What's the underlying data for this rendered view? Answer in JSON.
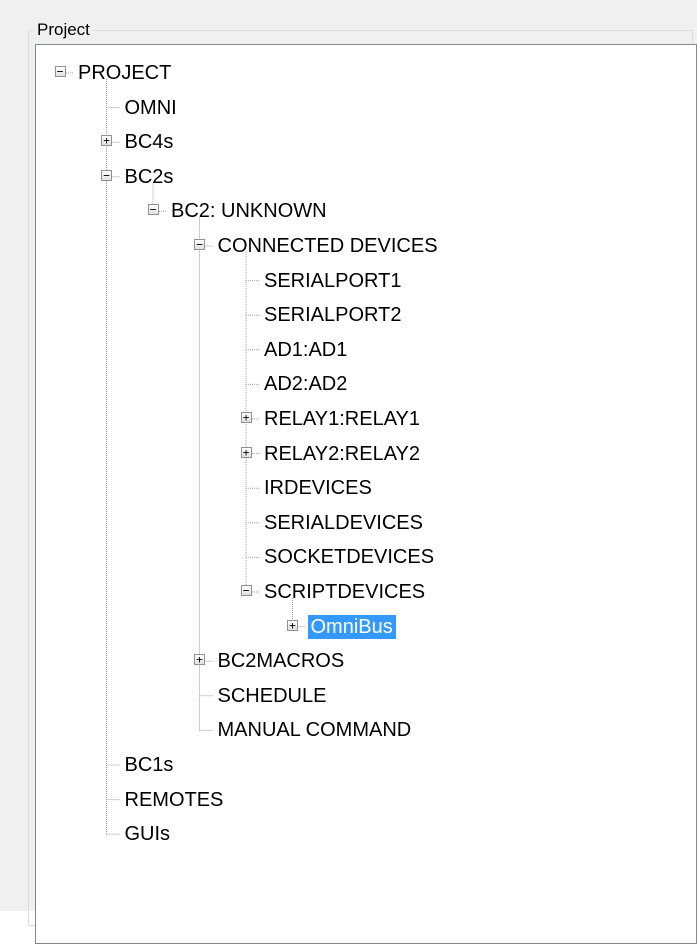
{
  "group": {
    "title": "Project"
  },
  "tree": {
    "nodes": [
      {
        "label": "PROJECT",
        "depth": 0,
        "expander": "minus",
        "selected": false
      },
      {
        "label": "OMNI",
        "depth": 1,
        "expander": "none",
        "selected": false
      },
      {
        "label": "BC4s",
        "depth": 1,
        "expander": "plus",
        "selected": false
      },
      {
        "label": "BC2s",
        "depth": 1,
        "expander": "minus",
        "selected": false
      },
      {
        "label": "BC2: UNKNOWN",
        "depth": 2,
        "expander": "minus",
        "selected": false
      },
      {
        "label": "CONNECTED DEVICES",
        "depth": 3,
        "expander": "minus",
        "selected": false
      },
      {
        "label": "SERIALPORT1",
        "depth": 4,
        "expander": "none",
        "selected": false
      },
      {
        "label": "SERIALPORT2",
        "depth": 4,
        "expander": "none",
        "selected": false
      },
      {
        "label": "AD1:AD1",
        "depth": 4,
        "expander": "none",
        "selected": false
      },
      {
        "label": "AD2:AD2",
        "depth": 4,
        "expander": "none",
        "selected": false
      },
      {
        "label": "RELAY1:RELAY1",
        "depth": 4,
        "expander": "plus",
        "selected": false
      },
      {
        "label": "RELAY2:RELAY2",
        "depth": 4,
        "expander": "plus",
        "selected": false
      },
      {
        "label": "IRDEVICES",
        "depth": 4,
        "expander": "none",
        "selected": false
      },
      {
        "label": "SERIALDEVICES",
        "depth": 4,
        "expander": "none",
        "selected": false
      },
      {
        "label": "SOCKETDEVICES",
        "depth": 4,
        "expander": "none",
        "selected": false
      },
      {
        "label": "SCRIPTDEVICES",
        "depth": 4,
        "expander": "minus",
        "selected": false
      },
      {
        "label": "OmniBus",
        "depth": 5,
        "expander": "plus",
        "selected": true
      },
      {
        "label": "BC2MACROS",
        "depth": 3,
        "expander": "plus",
        "selected": false
      },
      {
        "label": "SCHEDULE",
        "depth": 3,
        "expander": "none",
        "selected": false
      },
      {
        "label": "MANUAL COMMAND",
        "depth": 3,
        "expander": "none",
        "selected": false
      },
      {
        "label": "BC1s",
        "depth": 1,
        "expander": "none",
        "selected": false
      },
      {
        "label": "REMOTES",
        "depth": 1,
        "expander": "none",
        "selected": false
      },
      {
        "label": "GUIs",
        "depth": 1,
        "expander": "none",
        "selected": false
      }
    ]
  },
  "colors": {
    "selection": "#3399ff",
    "tree_lines": "#a0a0a0",
    "border": "#828790"
  }
}
